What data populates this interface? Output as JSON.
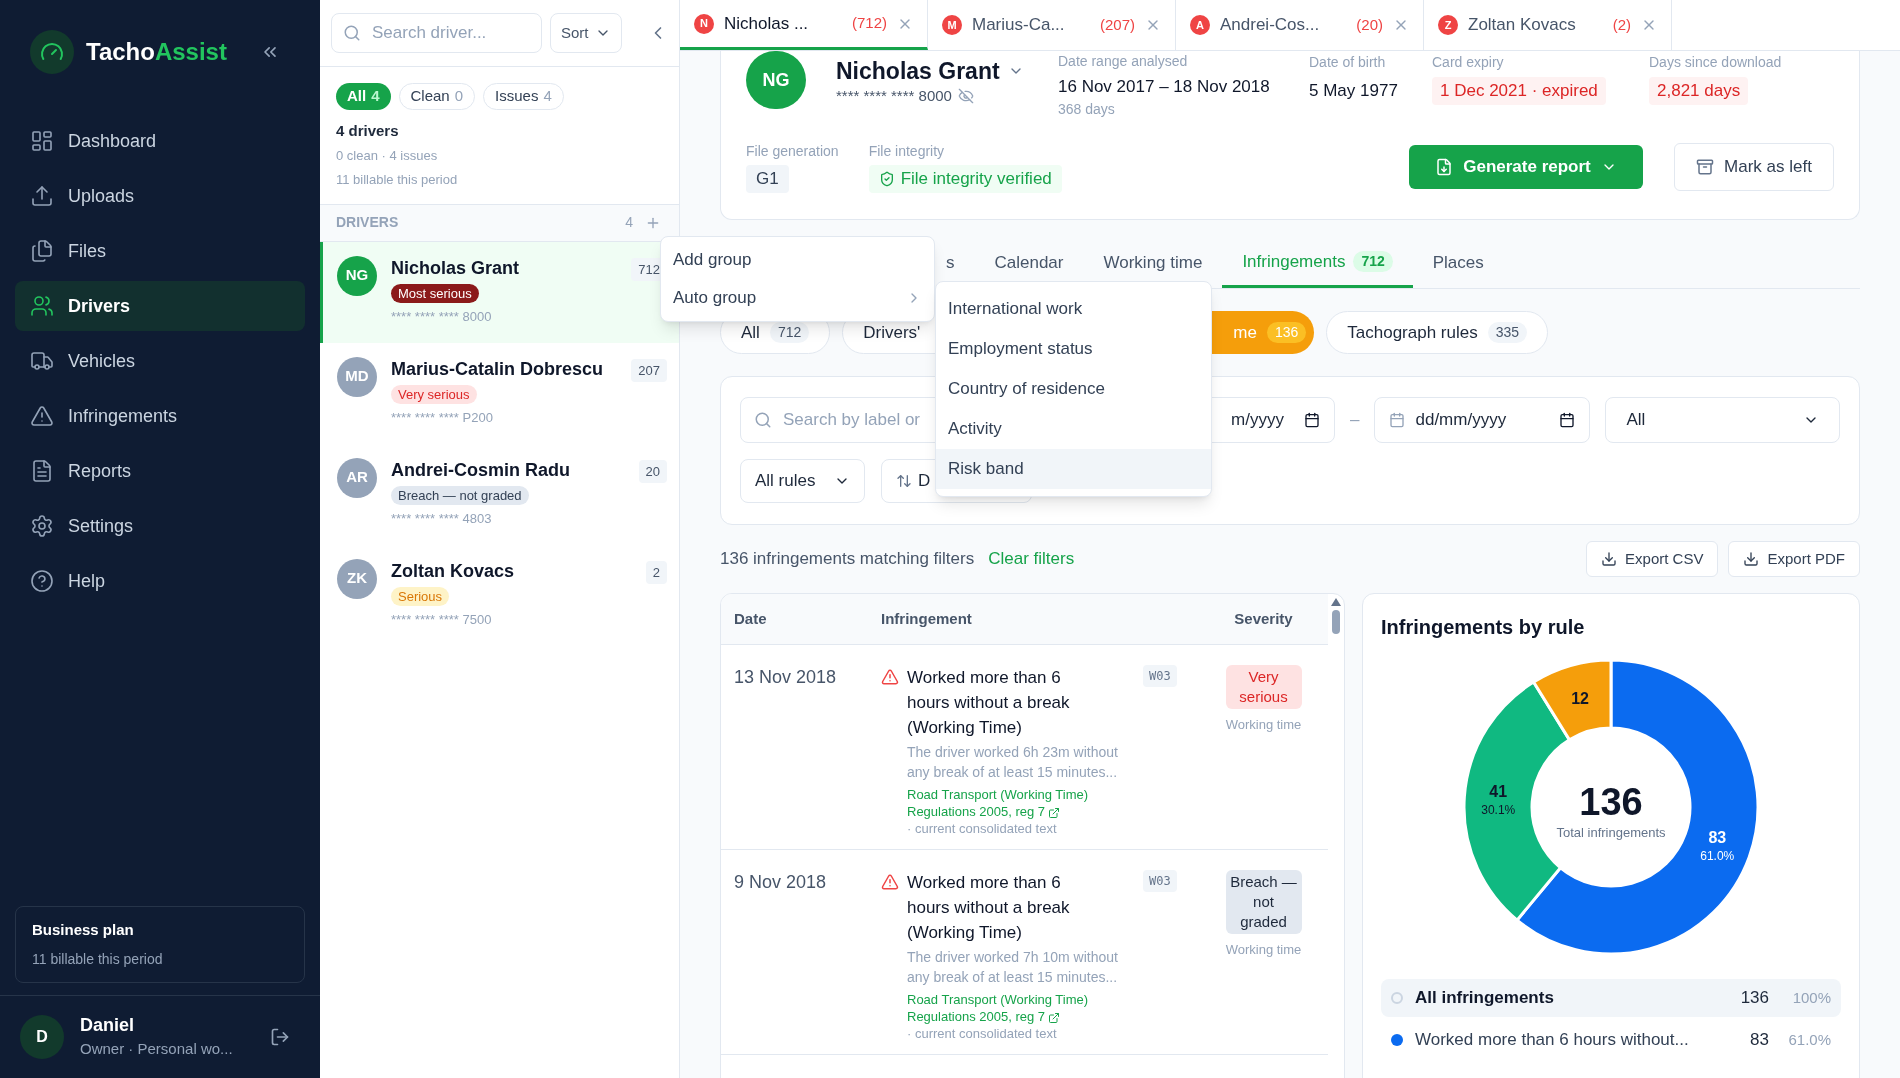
{
  "sidebar": {
    "brand_primary": "Tacho",
    "brand_accent": "Assist",
    "nav": [
      {
        "label": "Dashboard",
        "selected": false
      },
      {
        "label": "Uploads",
        "selected": false
      },
      {
        "label": "Files",
        "selected": false
      },
      {
        "label": "Drivers",
        "selected": true
      },
      {
        "label": "Vehicles",
        "selected": false
      },
      {
        "label": "Infringements",
        "selected": false
      },
      {
        "label": "Reports",
        "selected": false
      },
      {
        "label": "Settings",
        "selected": false
      },
      {
        "label": "Help",
        "selected": false
      }
    ],
    "plan": {
      "title": "Business plan",
      "subtitle": "11 billable this period"
    },
    "user": {
      "initial": "D",
      "name": "Daniel",
      "role": "Owner · Personal wo..."
    }
  },
  "driver_panel": {
    "search": {
      "placeholder": "Search driver..."
    },
    "sort_label": "Sort",
    "filters": [
      {
        "label": "All",
        "count": "4",
        "selected": true
      },
      {
        "label": "Clean",
        "count": "0",
        "selected": false
      },
      {
        "label": "Issues",
        "count": "4",
        "selected": false
      }
    ],
    "summary": {
      "title": "4 drivers",
      "detail": "0 clean · 4 issues",
      "billing": "11 billable this period"
    },
    "section": {
      "title": "DRIVERS",
      "count": "4"
    },
    "drivers": [
      {
        "initials": "NG",
        "name": "Nicholas Grant",
        "severity": "Most serious",
        "kind": "most",
        "card": "**** **** **** 8000",
        "count": "712",
        "selected": true
      },
      {
        "initials": "MD",
        "name": "Marius-Catalin Dobrescu",
        "severity": "Very serious",
        "kind": "very",
        "card": "**** **** **** P200",
        "count": "207",
        "selected": false
      },
      {
        "initials": "AR",
        "name": "Andrei-Cosmin Radu",
        "severity": "Breach — not graded",
        "kind": "breach",
        "card": "**** **** **** 4803",
        "count": "20",
        "selected": false
      },
      {
        "initials": "ZK",
        "name": "Zoltan Kovacs",
        "severity": "Serious",
        "kind": "serious",
        "card": "**** **** **** 7500",
        "count": "2",
        "selected": false
      }
    ]
  },
  "open_tabs": [
    {
      "initial": "N",
      "name": "Nicholas ...",
      "count": "(712)",
      "selected": true
    },
    {
      "initial": "M",
      "name": "Marius-Ca...",
      "count": "(207)",
      "selected": false
    },
    {
      "initial": "A",
      "name": "Andrei-Cos...",
      "count": "(20)",
      "selected": false
    },
    {
      "initial": "Z",
      "name": "Zoltan Kovacs",
      "count": "(2)",
      "selected": false
    }
  ],
  "driver_header": {
    "initials": "NG",
    "name": "Nicholas Grant",
    "card": "**** **** **** 8000",
    "date_range": {
      "label": "Date range analysed",
      "value": "16 Nov 2017 – 18 Nov 2018",
      "note": "368 days"
    },
    "birth": {
      "label": "Date of birth",
      "value": "5 May 1977"
    },
    "card_expiry": {
      "label": "Card expiry",
      "value": "1 Dec 2021 · expired"
    },
    "days_since_download": {
      "label": "Days since download",
      "value": "2,821 days"
    },
    "file_generation": {
      "label": "File generation",
      "value": "G1"
    },
    "file_integrity": {
      "label": "File integrity",
      "value": "File integrity verified"
    },
    "generate_button": "Generate report",
    "mark_left_button": "Mark as left"
  },
  "detail_tabs": [
    {
      "label": "s",
      "selected": false
    },
    {
      "label": "Calendar",
      "selected": false
    },
    {
      "label": "Working time",
      "selected": false
    },
    {
      "label": "Infringements",
      "count": "712",
      "selected": true
    },
    {
      "label": "Places",
      "selected": false
    }
  ],
  "category_chips": [
    {
      "label": "All",
      "count": "712",
      "selected": false
    },
    {
      "label": "Drivers'",
      "selected": false
    },
    {
      "label": "me",
      "count": "136",
      "selected": true
    },
    {
      "label": "Tachograph rules",
      "count": "335",
      "selected": false
    }
  ],
  "filters": {
    "search": {
      "placeholder": "Search by label or"
    },
    "date_from": "m/yyyy",
    "range_separator": "–",
    "date_to": "dd/mm/yyyy",
    "severity_select": "All",
    "rules_select": "All rules",
    "sort_label": "D"
  },
  "results": {
    "summary": "136 infringements matching filters",
    "clear": "Clear filters",
    "export_csv": "Export CSV",
    "export_pdf": "Export PDF"
  },
  "table": {
    "columns": [
      "Date",
      "Infringement",
      "Severity"
    ],
    "rows": [
      {
        "date": "13 Nov 2018",
        "title": "Worked more than 6 hours without a break (Working Time)",
        "code": "W03",
        "description": "The driver worked 6h 23m without any break of at least 15 minutes...",
        "law_link": "Road Transport (Working Time) Regulations 2005, reg 7",
        "law_note": "· current consolidated text",
        "severity": "Very serious",
        "kind": "very",
        "category": "Working time"
      },
      {
        "date": "9 Nov 2018",
        "title": "Worked more than 6 hours without a break (Working Time)",
        "code": "W03",
        "description": "The driver worked 7h 10m without any break of at least 15 minutes...",
        "law_link": "Road Transport (Working Time) Regulations 2005, reg 7",
        "law_note": "· current consolidated text",
        "severity": "Breach — not graded",
        "kind": "breach",
        "category": "Working time"
      }
    ]
  },
  "chart": {
    "center_value": "136",
    "center_label": "Total infringements",
    "chart_data": {
      "type": "donut",
      "title": "Infringements by rule",
      "values": [
        83,
        41,
        12
      ],
      "data_labels": true
    },
    "slices": [
      {
        "color": "#0b6bf0",
        "share": "61.0%"
      },
      {
        "color": "#10b981",
        "share": "30.1%"
      },
      {
        "color": "#f59e0b"
      }
    ],
    "legend": [
      {
        "kind": "total",
        "label": "All infringements",
        "count": "136",
        "share": "100%",
        "selected": true
      },
      {
        "kind": "rule",
        "label": "Worked more than 6 hours without...",
        "count": "83",
        "share": "61.0%",
        "color": "#0b6bf0",
        "selected": false
      }
    ]
  },
  "context_menu": {
    "items": [
      {
        "label": "Add group",
        "submenu": false
      },
      {
        "label": "Auto group",
        "submenu": true
      }
    ]
  },
  "submenu": {
    "items": [
      {
        "label": "International work",
        "selected": false
      },
      {
        "label": "Employment status",
        "selected": false
      },
      {
        "label": "Country of residence",
        "selected": false
      },
      {
        "label": "Activity",
        "selected": false
      },
      {
        "label": "Risk band",
        "selected": true
      }
    ]
  }
}
